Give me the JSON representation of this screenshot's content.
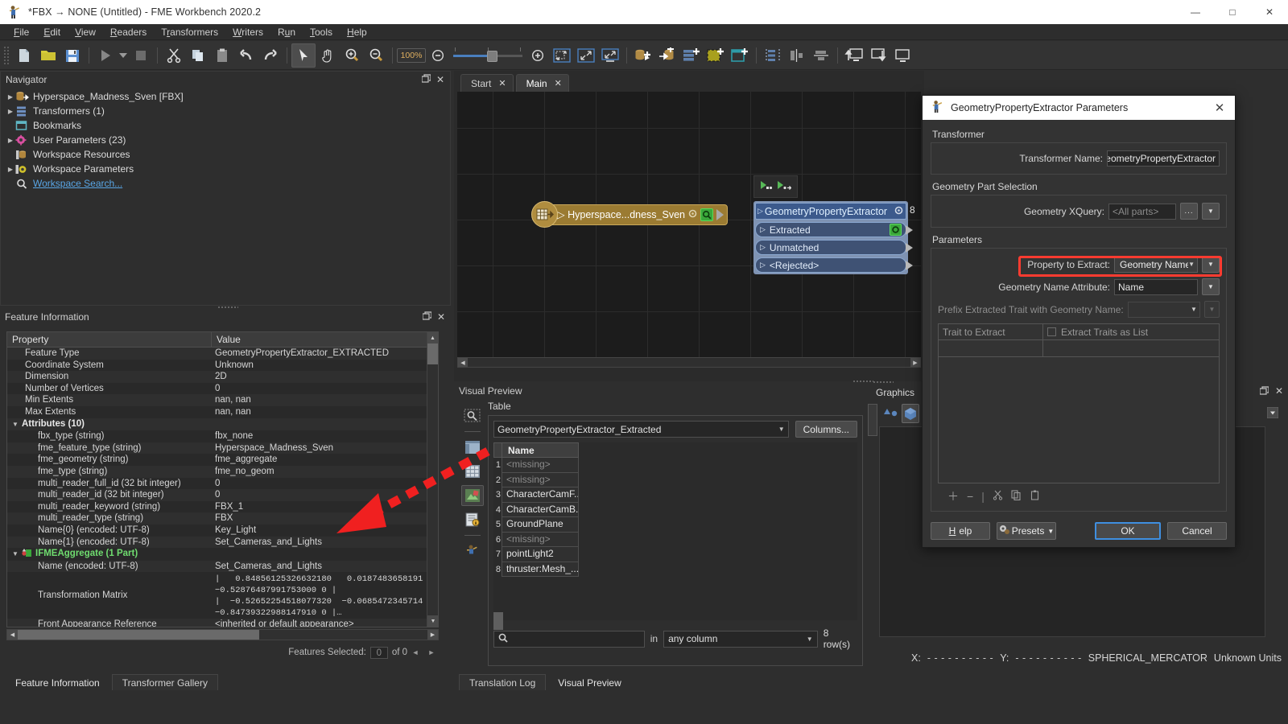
{
  "window": {
    "title": "*FBX → NONE (Untitled) - FME Workbench 2020.2",
    "app_icon": "fme-icon",
    "minimize": "—",
    "maximize": "□",
    "close": "✕"
  },
  "menu": [
    {
      "label": "File"
    },
    {
      "label": "Edit"
    },
    {
      "label": "View"
    },
    {
      "label": "Readers"
    },
    {
      "label": "Transformers"
    },
    {
      "label": "Writers"
    },
    {
      "label": "Run"
    },
    {
      "label": "Tools"
    },
    {
      "label": "Help"
    }
  ],
  "toolbar": {
    "zoom_value": "100%",
    "items": [
      "new-icon",
      "open-icon",
      "save-icon",
      "run-icon",
      "run-dropdown-icon",
      "stop-icon",
      "cut-icon",
      "copy-icon",
      "paste-icon",
      "undo-icon",
      "redo-icon",
      "select-pointer-icon",
      "pan-hand-icon",
      "zoom-in-icon",
      "zoom-out-icon",
      "zoom-out-step-icon",
      "zoom-slider",
      "zoom-in-step-icon",
      "zoom-to-selection-icon",
      "zoom-to-fit-icon",
      "zoom-to-window-icon",
      "add-reader-icon",
      "add-writer-icon",
      "add-transformer-icon",
      "add-bookmark-icon",
      "add-annotation-icon",
      "align-distribute-icon",
      "align-vertical-icon",
      "align-horizontal-icon",
      "attach-top-icon",
      "attach-bottom-icon",
      "detach-icon"
    ]
  },
  "navigator": {
    "title": "Navigator",
    "items": [
      {
        "label": "Hyperspace_Madness_Sven [FBX]",
        "icon": "reader-icon",
        "expandable": true
      },
      {
        "label": "Transformers (1)",
        "icon": "transformers-icon",
        "expandable": true
      },
      {
        "label": "Bookmarks",
        "icon": "bookmarks-icon",
        "expandable": false
      },
      {
        "label": "User Parameters (23)",
        "icon": "user-parameters-icon",
        "expandable": true
      },
      {
        "label": "Workspace Resources",
        "icon": "workspace-resources-icon",
        "expandable": false
      },
      {
        "label": "Workspace Parameters",
        "icon": "workspace-parameters-icon",
        "expandable": true
      },
      {
        "label": "Workspace Search...",
        "icon": "search-icon",
        "expandable": false,
        "link": true
      }
    ]
  },
  "feature_information": {
    "title": "Feature Information",
    "columns": [
      "Property",
      "Value"
    ],
    "rows": [
      {
        "property": "Feature Type",
        "value": "GeometryPropertyExtractor_EXTRACTED",
        "indent": 1
      },
      {
        "property": "Coordinate System",
        "value": "Unknown",
        "indent": 1
      },
      {
        "property": "Dimension",
        "value": "2D",
        "indent": 1
      },
      {
        "property": "Number of Vertices",
        "value": "0",
        "indent": 1
      },
      {
        "property": "Min Extents",
        "value": "nan, nan",
        "indent": 1
      },
      {
        "property": "Max Extents",
        "value": "nan, nan",
        "indent": 1
      },
      {
        "property": "Attributes (10)",
        "value": "",
        "indent": 0,
        "group": true,
        "toggle": "▼"
      },
      {
        "property": "fbx_type (string)",
        "value": "fbx_none",
        "indent": 2
      },
      {
        "property": "fme_feature_type (string)",
        "value": "Hyperspace_Madness_Sven",
        "indent": 2
      },
      {
        "property": "fme_geometry (string)",
        "value": "fme_aggregate",
        "indent": 2
      },
      {
        "property": "fme_type (string)",
        "value": "fme_no_geom",
        "indent": 2
      },
      {
        "property": "multi_reader_full_id (32 bit integer)",
        "value": "0",
        "indent": 2
      },
      {
        "property": "multi_reader_id (32 bit integer)",
        "value": "0",
        "indent": 2
      },
      {
        "property": "multi_reader_keyword (string)",
        "value": "FBX_1",
        "indent": 2
      },
      {
        "property": "multi_reader_type (string)",
        "value": "FBX",
        "indent": 2
      },
      {
        "property": "Name{0} (encoded: UTF-8)",
        "value": "Key_Light",
        "indent": 2
      },
      {
        "property": "Name{1} (encoded: UTF-8)",
        "value": "Set_Cameras_and_Lights",
        "indent": 2
      },
      {
        "property": "IFMEAggregate (1 Part)",
        "value": "",
        "indent": 0,
        "group": true,
        "aggregate": true,
        "toggle": "▼"
      },
      {
        "property": "Name (encoded: UTF-8)",
        "value": "Set_Cameras_and_Lights",
        "indent": 2
      },
      {
        "property": "Transformation Matrix",
        "value": "|   0.84856125326632180   0.0187483658191\n−0.52876487991753000 0 |\n|  −0.52652254518077320  −0.0685472345714\n−0.84739322988147910 0 |…",
        "indent": 2,
        "multiline": true
      },
      {
        "property": "Front Appearance Reference",
        "value": "<inherited or default appearance>",
        "indent": 2
      }
    ],
    "footer": {
      "label": "Features Selected:",
      "count": "0",
      "of": "of 0",
      "prev": "◄",
      "next": "►"
    }
  },
  "left_tabs": [
    {
      "label": "Feature Information",
      "active": true
    },
    {
      "label": "Transformer Gallery",
      "active": false
    }
  ],
  "canvas": {
    "tabs": [
      {
        "label": "Start",
        "active": false,
        "close": "✕"
      },
      {
        "label": "Main",
        "active": true,
        "close": "✕"
      }
    ],
    "reader_node": {
      "label": "▷ Hyperspace...dness_Sven",
      "gear_icon": "gear-icon",
      "inspect_icon": "magnifier-icon",
      "reader_icon": "reader-table-icon"
    },
    "link_count": "8",
    "transformer_node": {
      "title": "GeometryPropertyExtractor",
      "gear_icon": "gear-icon",
      "outputs": [
        {
          "label": "Extracted",
          "badge": "inspect-badge-icon",
          "count": "8"
        },
        {
          "label": "Unmatched",
          "badge": "",
          "count": ""
        },
        {
          "label": "<Rejected>",
          "badge": "",
          "count": ""
        }
      ]
    },
    "annotation_icons": [
      "feature-caching-icon",
      "feature-caching-run-icon"
    ]
  },
  "visual_preview": {
    "title": "Visual Preview",
    "table_label": "Table",
    "dataset": "GeometryPropertyExtractor_Extracted",
    "columns_button": "Columns...",
    "icons": [
      "inspect-mode-icon",
      "table-layout-icon",
      "grid-view-icon",
      "graphics-view-icon",
      "info-view-icon",
      "fme-view-icon"
    ],
    "table": {
      "header": "Name",
      "rows": [
        {
          "num": "1",
          "name": "<missing>",
          "missing": true
        },
        {
          "num": "2",
          "name": "<missing>",
          "missing": true
        },
        {
          "num": "3",
          "name": "CharacterCamF...",
          "missing": false
        },
        {
          "num": "4",
          "name": "CharacterCamB...",
          "missing": false
        },
        {
          "num": "5",
          "name": "GroundPlane",
          "missing": false
        },
        {
          "num": "6",
          "name": "<missing>",
          "missing": true
        },
        {
          "num": "7",
          "name": "pointLight2",
          "missing": false
        },
        {
          "num": "8",
          "name": "thruster:Mesh_...",
          "missing": false
        }
      ]
    },
    "search": {
      "placeholder": "",
      "icon": "search-icon",
      "in_label": "in",
      "scope": "any column",
      "row_count": "8 row(s)"
    }
  },
  "graphics": {
    "title": "Graphics",
    "toolbar_icons": [
      "shapes-icon",
      "cube-icon",
      "camera-icon"
    ],
    "status": {
      "x_label": "X:",
      "x_value": "- - - - - - - - - -",
      "y_label": "Y:",
      "y_value": "- - - - - - - - - -",
      "coord_system": "SPHERICAL_MERCATOR",
      "units": "Unknown Units"
    }
  },
  "bottom_tabs": [
    {
      "label": "Translation Log",
      "active": false
    },
    {
      "label": "Visual Preview",
      "active": true
    }
  ],
  "dialog": {
    "title": "GeometryPropertyExtractor Parameters",
    "icon": "fme-icon",
    "close": "✕",
    "sections": [
      {
        "label": "Transformer",
        "fields": [
          {
            "label": "Transformer Name:",
            "type": "text",
            "value": "GeometryPropertyExtractor"
          }
        ]
      },
      {
        "label": "Geometry Part Selection",
        "fields": [
          {
            "label": "Geometry XQuery:",
            "type": "text",
            "value": "<All parts>",
            "placeholder": true,
            "buttons": [
              "...",
              "▼"
            ]
          }
        ]
      },
      {
        "label": "Parameters",
        "fields": [
          {
            "label": "Property to Extract:",
            "type": "combo",
            "value": "Geometry Name",
            "highlighted": true,
            "buttons": [
              "▼"
            ]
          },
          {
            "label": "Geometry Name Attribute:",
            "type": "text",
            "value": "Name",
            "buttons": [
              "▼"
            ]
          },
          {
            "label": "Prefix Extracted Trait with Geometry Name:",
            "type": "combo",
            "value": "",
            "disabled": true,
            "buttons": [
              "▼"
            ]
          }
        ]
      }
    ],
    "trait_table": {
      "col1": "Trait to Extract",
      "checkbox_label": "Extract Traits as List",
      "checked": false,
      "row_tools": [
        "add-row-icon",
        "remove-row-icon",
        "separator",
        "cut-icon",
        "copy-icon",
        "paste-icon"
      ]
    },
    "buttons": {
      "help": "Help",
      "presets": "Presets",
      "ok": "OK",
      "cancel": "Cancel"
    }
  },
  "colors": {
    "accent_blue": "#3f8fe0",
    "highlight_red": "#ff3b30",
    "reader_gold": "#9b7b32",
    "transformer_blue": "#3c5a8c",
    "link_cyan": "#59a6e6"
  }
}
